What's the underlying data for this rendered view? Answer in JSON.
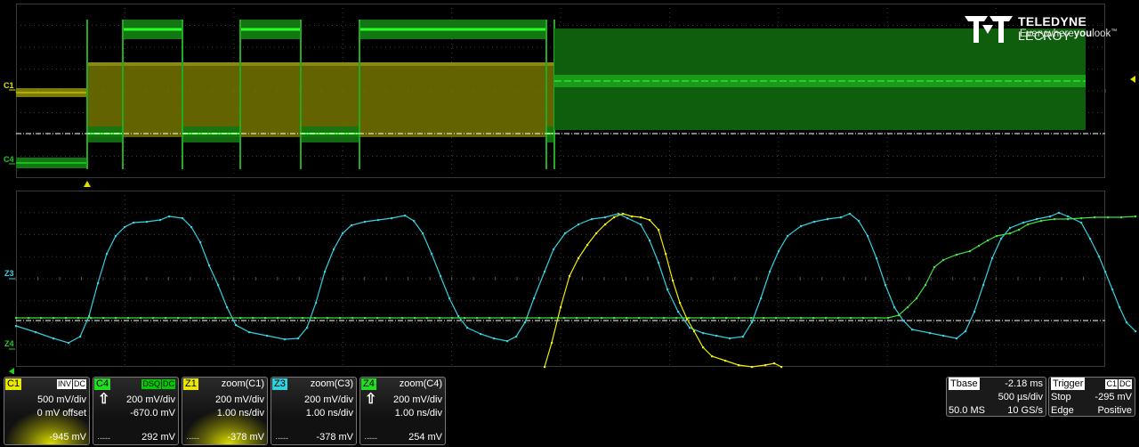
{
  "brand": {
    "name_bold": "TELEDYNE",
    "name_light": "LECROY",
    "tagline_a": "Everywhere",
    "tagline_b": "you",
    "tagline_c": "look",
    "tagline_tm": "™"
  },
  "channel_labels": {
    "c1": "C1",
    "c4": "C4",
    "z3": "Z3",
    "z4": "Z4"
  },
  "colors": {
    "c1": "#e0e000",
    "c4": "#22cc22",
    "z1": "#f0f000",
    "z3": "#33d0e0",
    "z4": "#22cc22",
    "grid": "#3a3a3a"
  },
  "descriptors": [
    {
      "id": "C1",
      "color": "#e8e800",
      "flags": [
        "INV",
        "DC"
      ],
      "line1": "500 mV/div",
      "line2": "0 mV offset",
      "value": "-945 mV",
      "arrow": "",
      "dashes": ""
    },
    {
      "id": "C4",
      "color": "#22dd22",
      "flags": [
        "DSQ",
        "DC"
      ],
      "line1": "200 mV/div",
      "line2": "-670.0 mV",
      "value": "292 mV",
      "arrow": "⇧",
      "dashes": "·----"
    },
    {
      "id": "Z1",
      "color": "#e8e800",
      "title": "zoom(C1)",
      "line1": "200 mV/div",
      "line2": "1.00 ns/div",
      "value": "-378 mV",
      "arrow": "",
      "dashes": "·----"
    },
    {
      "id": "Z3",
      "color": "#33d0e0",
      "title": "zoom(C3)",
      "line1": "200 mV/div",
      "line2": "1.00 ns/div",
      "value": "-378 mV",
      "arrow": "",
      "dashes": "·----"
    },
    {
      "id": "Z4",
      "color": "#22dd22",
      "title": "zoom(C4)",
      "line1": "200 mV/div",
      "line2": "1.00 ns/div",
      "value": "254 mV",
      "arrow": "⇧",
      "dashes": "·----"
    }
  ],
  "timebase": {
    "title": "Tbase",
    "delay": "-2.18 ms",
    "per_div": "500 µs/div",
    "samples": "50.0 MS",
    "rate": "10 GS/s"
  },
  "trigger": {
    "title": "Trigger",
    "source": "C1",
    "coupling": "DC",
    "mode": "Stop",
    "level": "-295 mV",
    "type": "Edge",
    "slope": "Positive"
  }
}
